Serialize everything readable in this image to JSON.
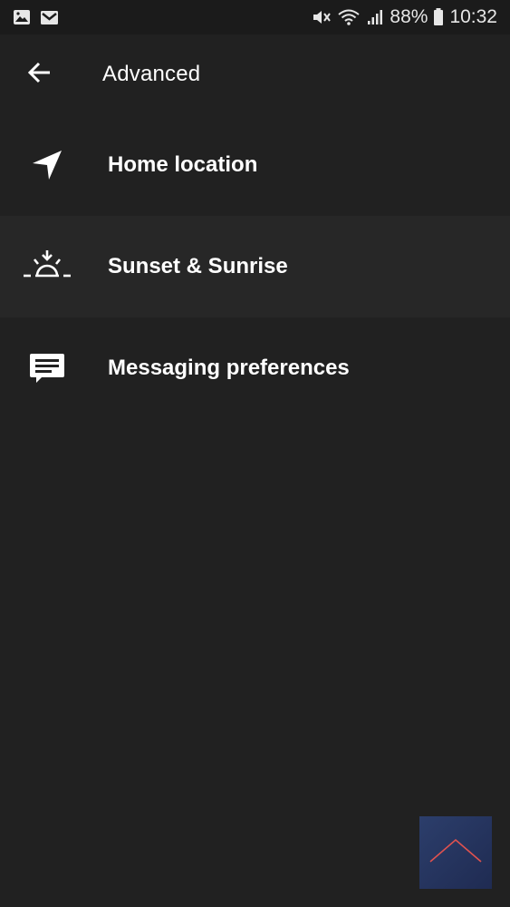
{
  "status_bar": {
    "battery_percent": "88%",
    "time": "10:32",
    "icons": [
      "image-icon",
      "gmail-icon",
      "mute-icon",
      "wifi-icon",
      "signal-icon",
      "battery-icon"
    ]
  },
  "app_bar": {
    "title": "Advanced",
    "back_icon": "arrow-left-icon"
  },
  "menu": {
    "items": [
      {
        "label": "Home location",
        "icon": "navigation-arrow-icon",
        "selected": false
      },
      {
        "label": "Sunset & Sunrise",
        "icon": "sunrise-icon",
        "selected": true
      },
      {
        "label": "Messaging preferences",
        "icon": "message-icon",
        "selected": false
      }
    ]
  },
  "fab": {
    "icon": "chevron-up-icon",
    "accent_color": "#e0524f"
  },
  "colors": {
    "background": "#212121",
    "status_bar": "#1b1b1b",
    "selected_row": "#272727",
    "text": "#ffffff"
  }
}
